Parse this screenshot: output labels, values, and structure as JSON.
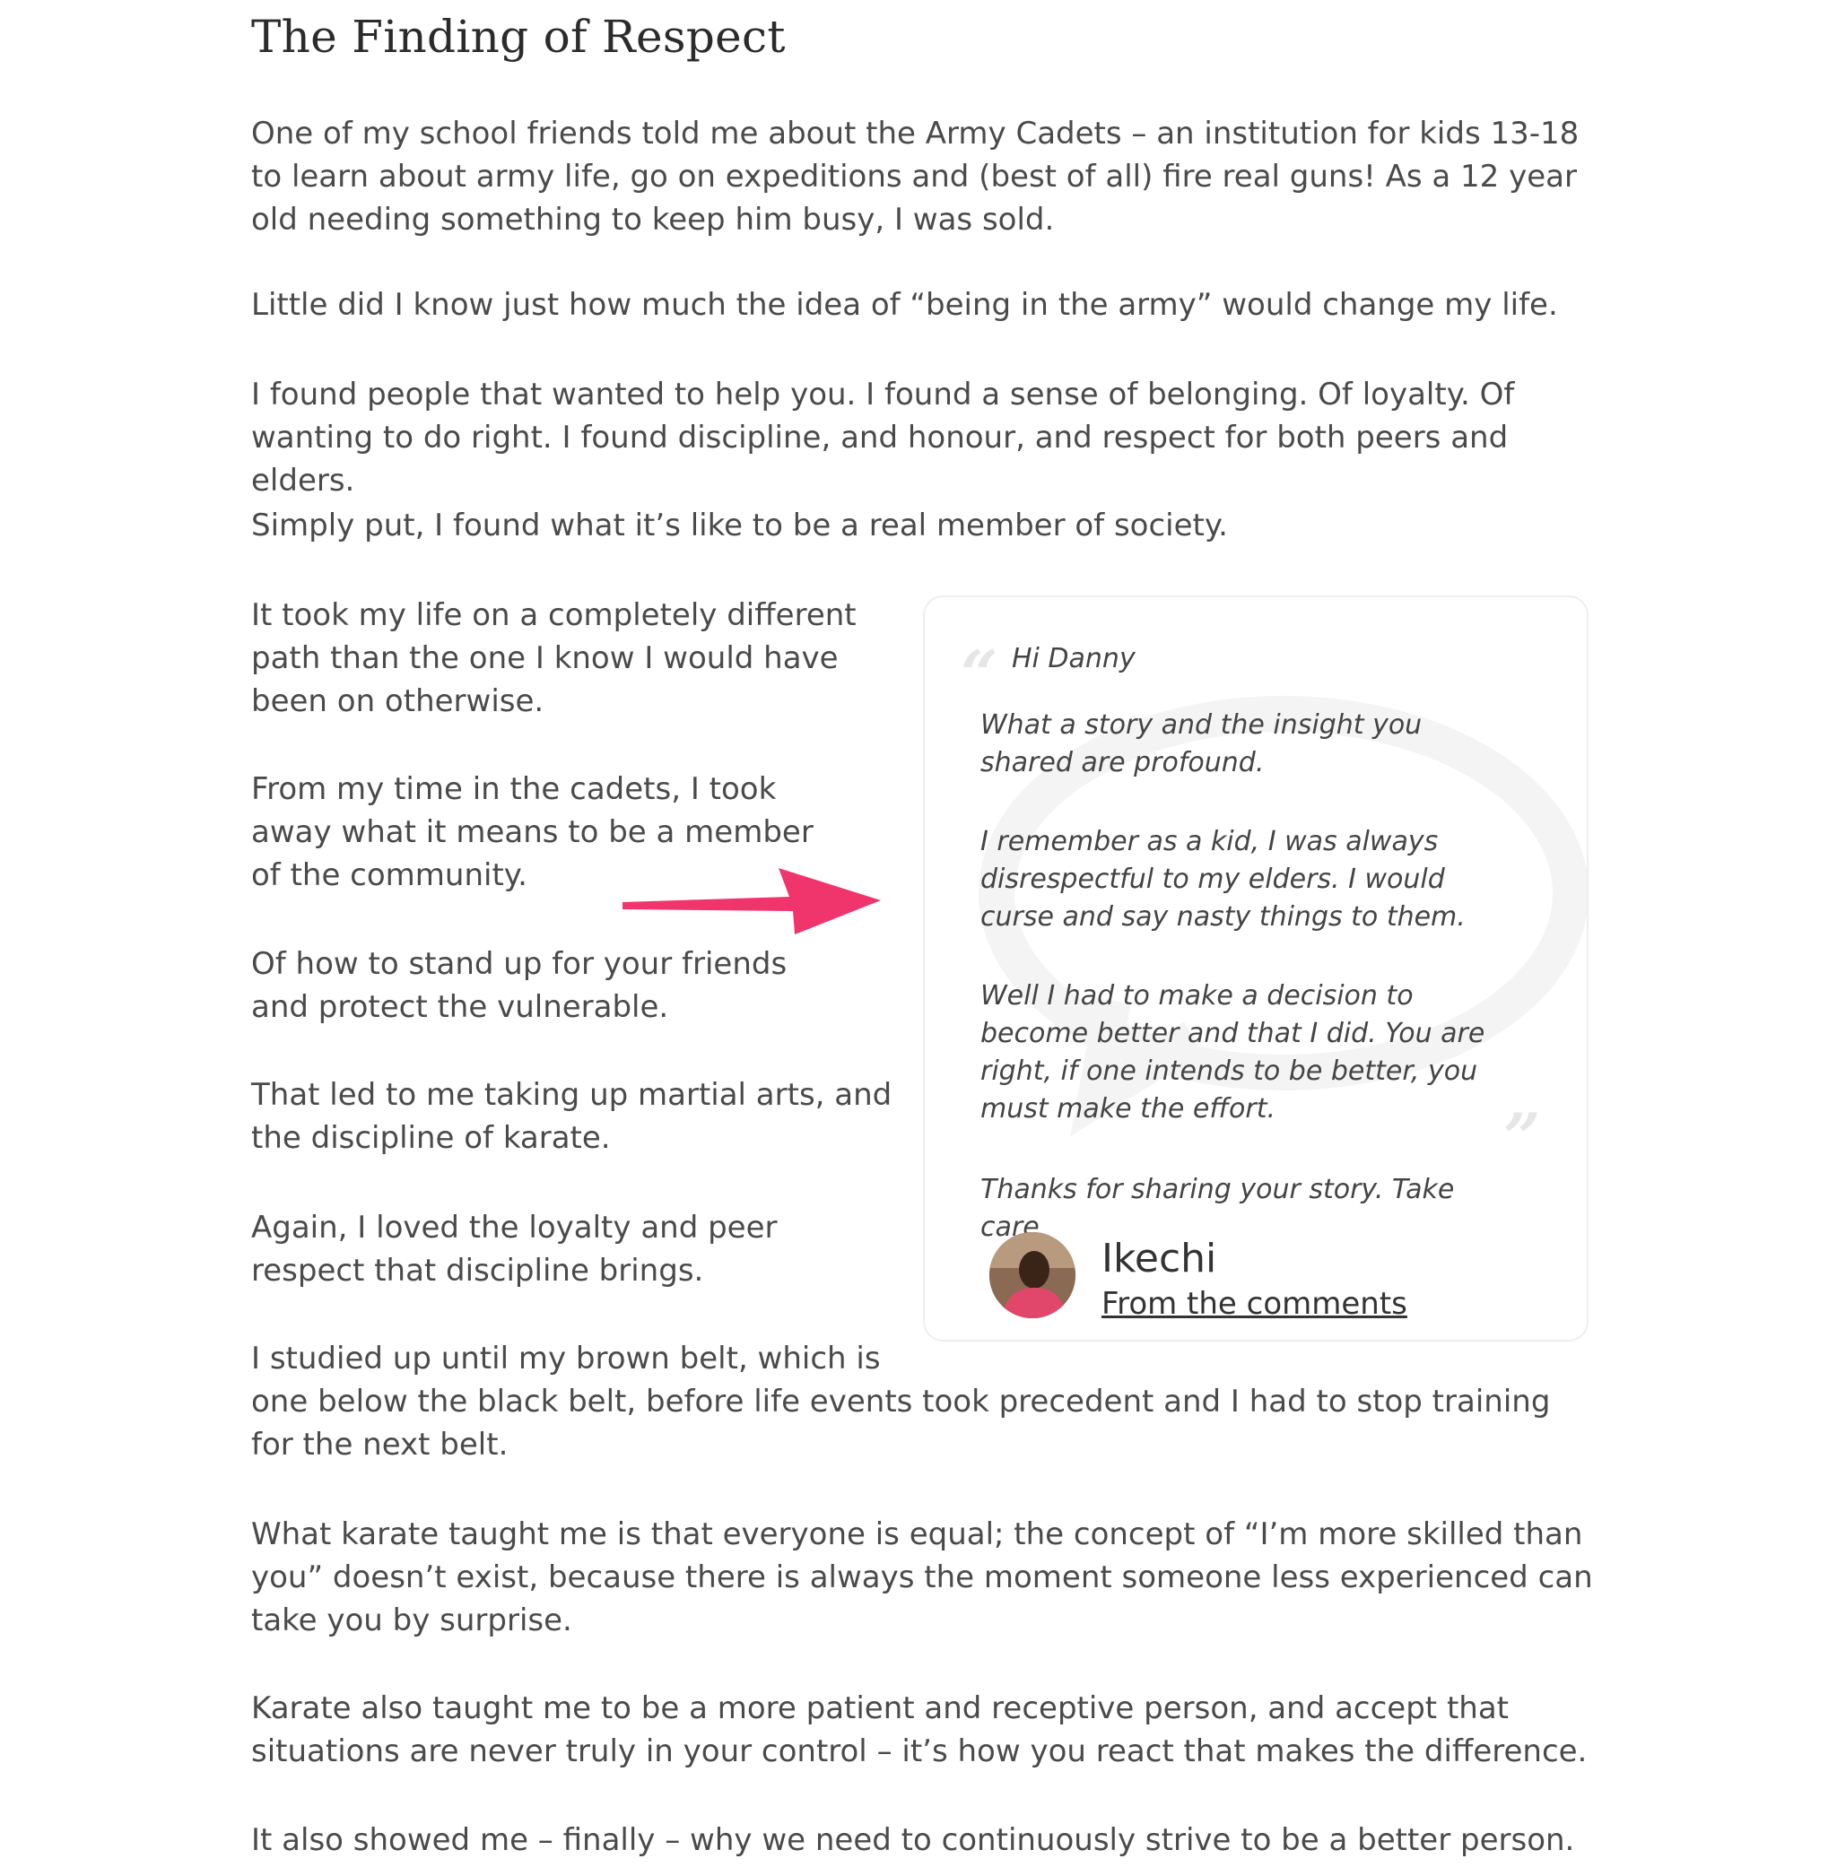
{
  "article": {
    "title": "The Finding of Respect",
    "paragraphs": [
      "One of my school friends told me about the Army Cadets – an institution for kids 13-18 to learn about army life, go on expeditions and (best of all) fire real guns! As a 12 year old needing something to keep him busy, I was sold.",
      "Little did I know just how much the idea of “being in the army” would change my life.",
      "I found people that wanted to help you. I found a sense of belonging. Of loyalty. Of wanting to do right. I found discipline, and honour, and respect for both peers and elders.",
      "Simply put, I found what it’s like to be a real member of society.",
      "It took my life on a completely different path than the one I know I would have been on otherwise.",
      "From my time in the cadets, I took away what it means to be a member of the community.",
      "Of how to stand up for your friends and protect the vulnerable.",
      "That led to me taking up martial arts, and the discipline of karate.",
      "Again, I loved the loyalty and peer respect that discipline brings.",
      "I studied up until my brown belt, which is",
      "one below the black belt, before life events took precedent and I had to stop training for the next belt.",
      "What karate taught me is that everyone is equal; the concept of “I’m more skilled than you” doesn’t exist, because there is always the moment someone less experienced can take you by surprise.",
      "Karate also taught me to be a more patient and receptive person, and accept that situations are never truly in your control – it’s how you react that makes the difference.",
      "It also showed me – finally – why we need to continuously strive to be a better person."
    ]
  },
  "testimonial": {
    "open_quote": "“",
    "close_quote": "”",
    "lines": [
      "Hi Danny",
      "What a story and the insight you shared are profound.",
      "I remember as a kid, I was always disrespectful to my elders. I would curse and say nasty things to them.",
      "Well I had to make a decision to become better and that I did. You are right, if one intends to be better, you must make the effort.",
      "Thanks for sharing your story. Take care"
    ],
    "author": "Ikechi",
    "source": "From the comments"
  },
  "colors": {
    "text": "#4a4a4a",
    "title": "#2b2b2b",
    "arrow": "#f0356d",
    "card_border": "#eeeeee"
  },
  "icons": {
    "arrow": "arrow-right-icon",
    "quote": "quote-icon"
  }
}
